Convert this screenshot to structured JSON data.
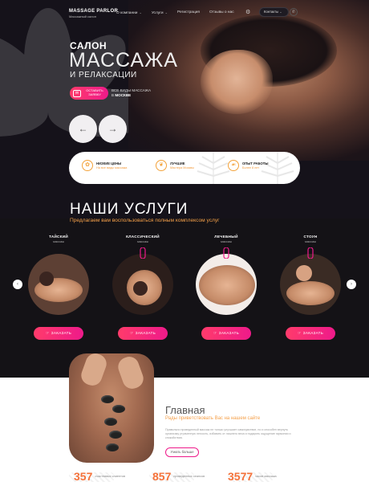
{
  "header": {
    "brand": "MASSAGE PARLOR",
    "brand_sub": "Массажный салон",
    "nav": [
      {
        "label": "О компании",
        "has_dropdown": true
      },
      {
        "label": "Услуги",
        "has_dropdown": true
      },
      {
        "label": "Регистрация",
        "has_dropdown": false
      },
      {
        "label": "Отзывы о нас",
        "has_dropdown": false
      }
    ],
    "contacts_label": "Контакты",
    "icons": [
      "gear-icon",
      "phone-icon"
    ]
  },
  "hero": {
    "line1": "САЛОН",
    "line2": "МАССАЖА",
    "line3": "И РЕЛАКСАЦИИ",
    "leave_request": "ОСТАВИТЬ ЗАЯВКУ",
    "all_types_line1": "ВСЕ ВИДЫ МАССАЖА",
    "all_types_prefix": "В ",
    "all_types_city": "МОСКВЕ",
    "prev": "←",
    "next": "→"
  },
  "features": [
    {
      "title": "НИЗКИЕ ЦЕНЫ",
      "sub": "На все виды массажа",
      "icon": "tag-icon"
    },
    {
      "title": "ЛУЧШИЕ",
      "sub": "Мастера Москвы",
      "icon": "star-icon"
    },
    {
      "title": "ОПЫТ РАБОТЫ",
      "sub": "Более 8 лет",
      "icon": "hand-icon"
    }
  ],
  "services": {
    "title": "НАШИ УСЛУГИ",
    "subtitle": "Предлагаем вам воспользоваться полным комплексом услуг",
    "items": [
      {
        "name": "ТАЙСКИЙ",
        "sub": "массаж",
        "order": "ЗАКАЗАТЬ"
      },
      {
        "name": "КЛАССИЧЕСКИЙ",
        "sub": "массаж",
        "order": "ЗАКАЗАТЬ"
      },
      {
        "name": "ЛЕЧЕБНЫЙ",
        "sub": "массаж",
        "order": "ЗАКАЗАТЬ"
      },
      {
        "name": "СТОУН",
        "sub": "массаж",
        "order": "ЗАКАЗАТЬ"
      }
    ],
    "prev": "‹",
    "next": "›"
  },
  "welcome": {
    "title": "Главная",
    "subtitle": "Рады приветствовать Вас на нашем сайте",
    "text": "Правильно проведенный массаж не только улучшает самочувствие, но и способен вернуть организму утраченную легкость, избавить от лишнего веса и подарить ощущение гармонии и спокойствия.",
    "button": "Узнать больше"
  },
  "stats": [
    {
      "num": "357",
      "label": "счастливых клиентов"
    },
    {
      "num": "857",
      "label": "проведенных сеансов"
    },
    {
      "num": "3577",
      "label": "часов массажа"
    }
  ],
  "colors": {
    "accent_pink": "#ee1a8a",
    "accent_coral": "#ff3b6b",
    "accent_orange": "#f5a04a",
    "dark_bg": "#141216"
  }
}
